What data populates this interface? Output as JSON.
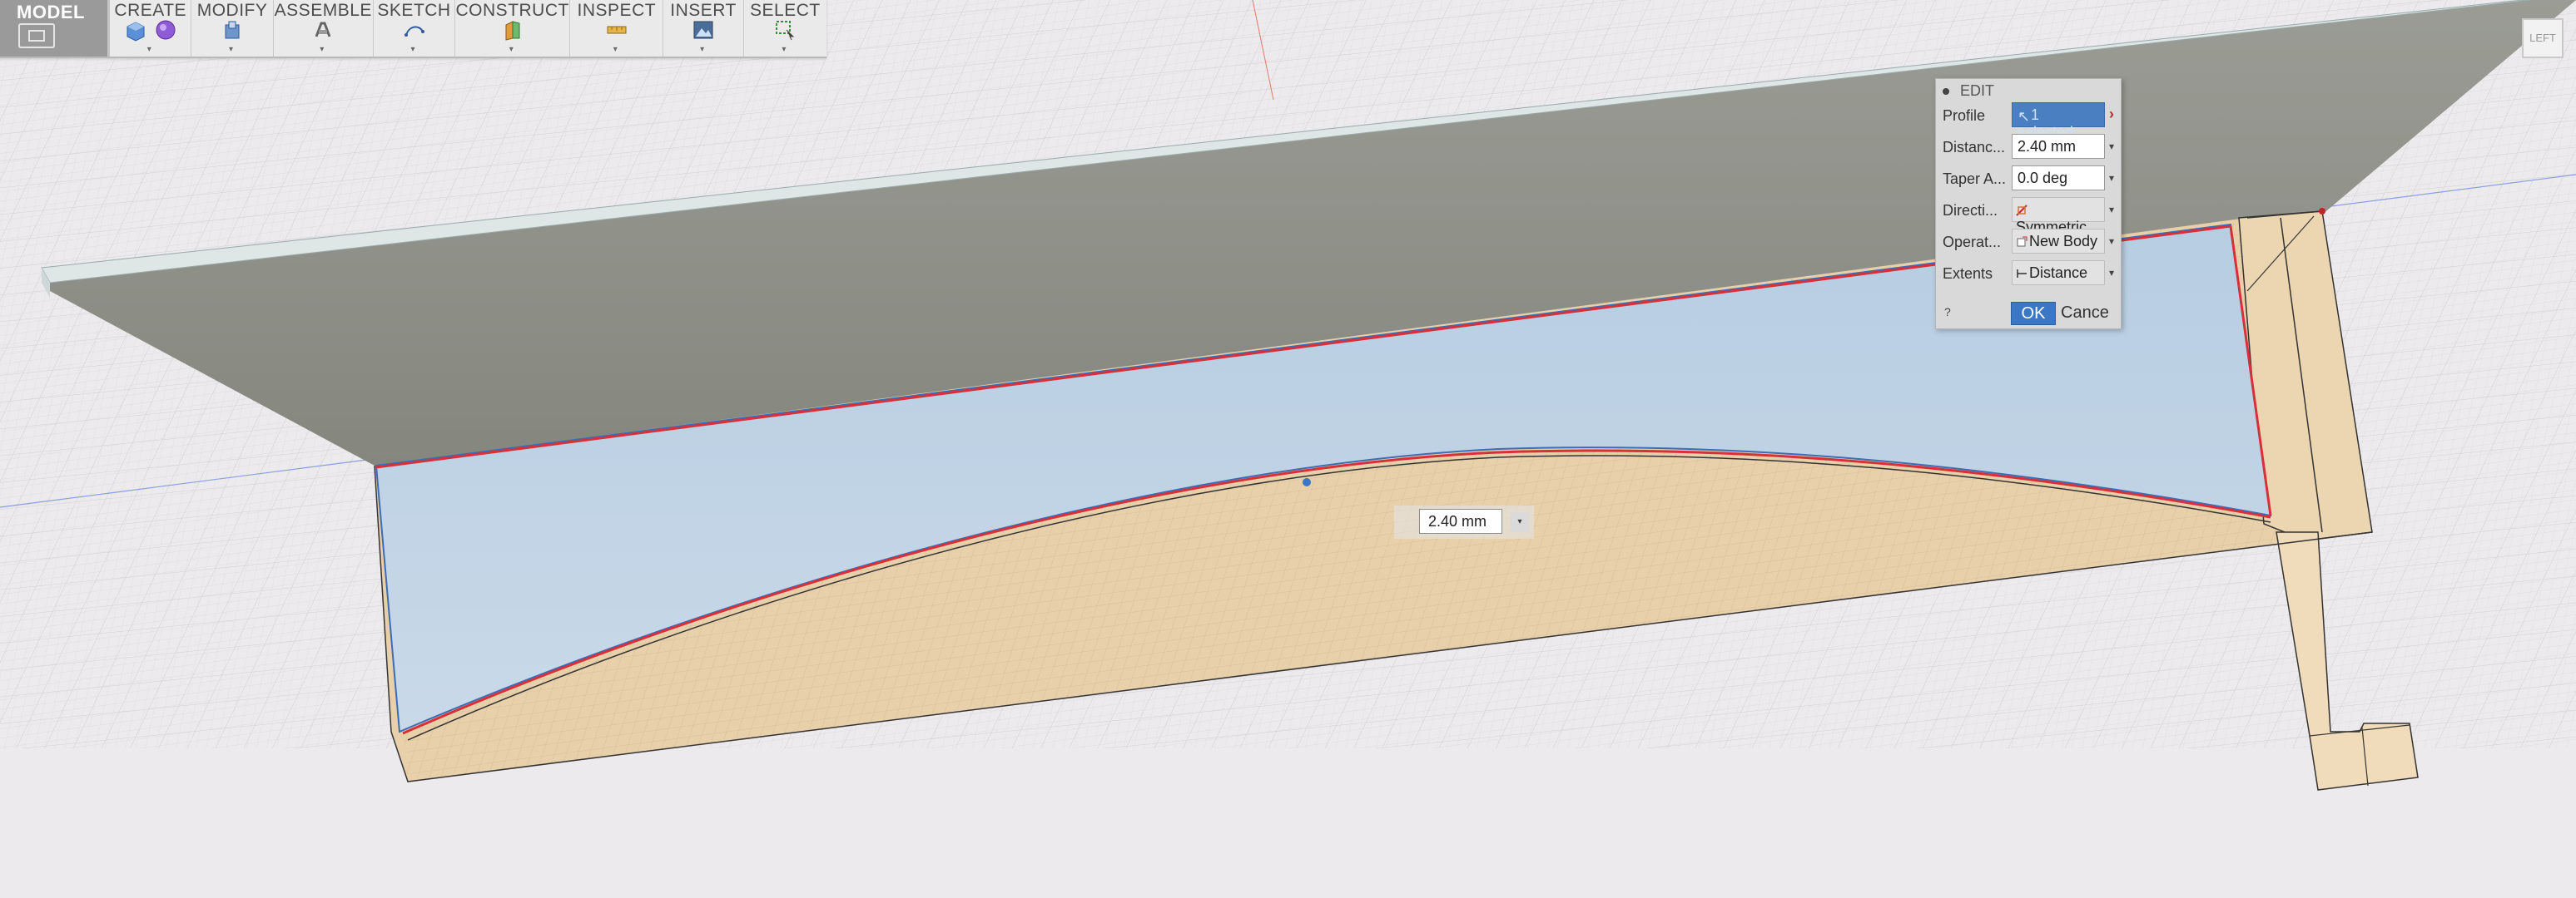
{
  "toolbar": {
    "workspace_label": "MODEL",
    "groups": [
      {
        "label": "CREATE"
      },
      {
        "label": "MODIFY"
      },
      {
        "label": "ASSEMBLE"
      },
      {
        "label": "SKETCH"
      },
      {
        "label": "CONSTRUCT"
      },
      {
        "label": "INSPECT"
      },
      {
        "label": "INSERT"
      },
      {
        "label": "SELECT"
      }
    ]
  },
  "viewcube": {
    "label": "LEFT"
  },
  "edit_panel": {
    "title": "EDIT",
    "rows": [
      {
        "label": "Profile",
        "value": "1 selected"
      },
      {
        "label": "Distanc...",
        "value": "2.40 mm"
      },
      {
        "label": "Taper A...",
        "value": "0.0 deg"
      },
      {
        "label": "Directi...",
        "value": "Symmetric"
      },
      {
        "label": "Operat...",
        "value": "New Body"
      },
      {
        "label": "Extents",
        "value": "Distance"
      }
    ],
    "help_label": "?",
    "ok_label": "OK",
    "cancel_label": "Cance"
  },
  "distance_input": {
    "value": "2.40 mm"
  },
  "colors": {
    "viewport_bg": "#eceaec",
    "grid_line": "#c8c8ca",
    "top_face": "#8f918a",
    "profile_blue": "#b8cde0",
    "body_tan": "#e9d2ad",
    "edge_red": "#d8303a",
    "selection_blue": "#4a7fc1"
  }
}
